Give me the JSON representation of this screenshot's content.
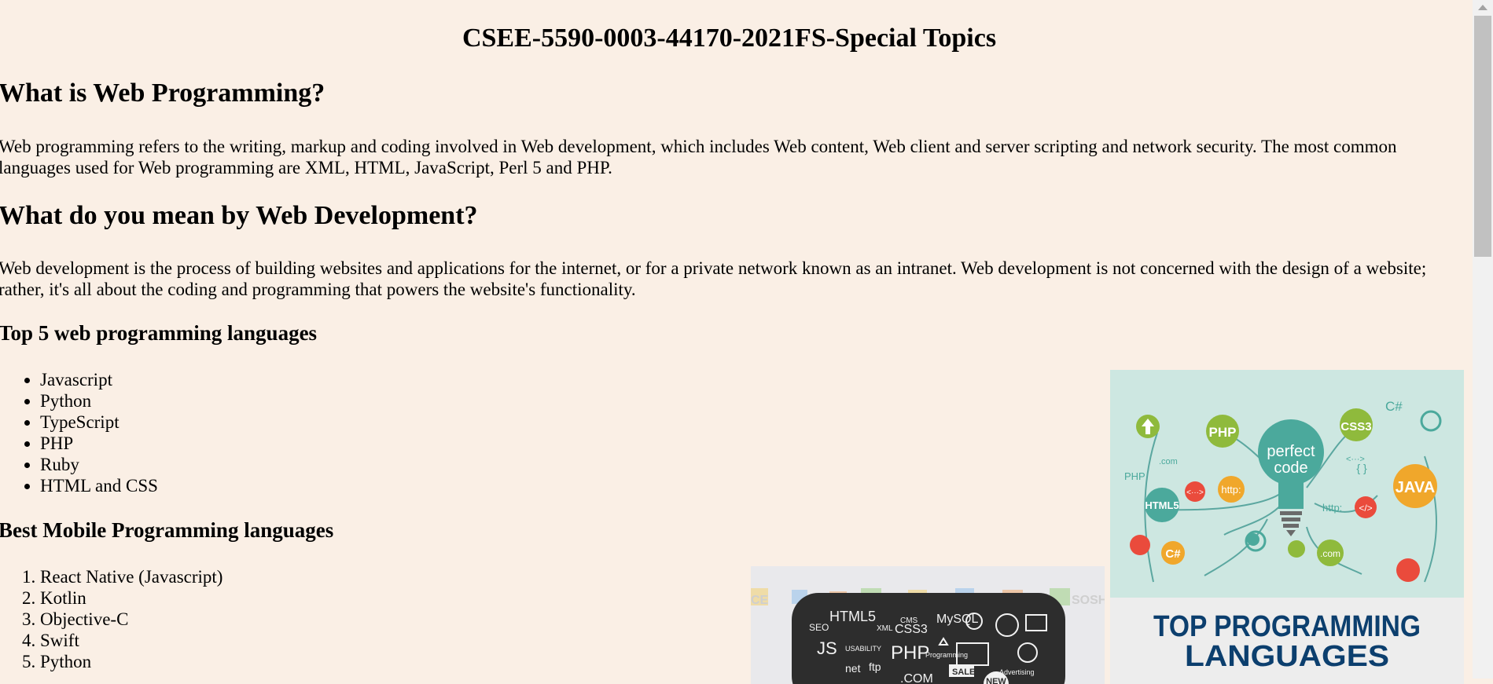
{
  "page": {
    "title": "CSEE-5590-0003-44170-2021FS-Special Topics"
  },
  "sections": {
    "web_programming": {
      "heading": "What is Web Programming?",
      "text": "Web programming refers to the writing, markup and coding involved in Web development, which includes Web content, Web client and server scripting and network security. The most common languages used for Web programming are XML, HTML, JavaScript, Perl 5 and PHP."
    },
    "web_development": {
      "heading": "What do you mean by Web Development?",
      "text": "Web development is the process of building websites and applications for the internet, or for a private network known as an intranet. Web development is not concerned with the design of a website; rather, it's all about the coding and programming that powers the website's functionality."
    },
    "top_web_languages": {
      "heading": "Top 5 web programming languages",
      "items": [
        "Javascript",
        "Python",
        "TypeScript",
        "PHP",
        "Ruby",
        "HTML and CSS"
      ]
    },
    "mobile_languages": {
      "heading": "Best Mobile Programming languages",
      "items": [
        "React Native (Javascript)",
        "Kotlin",
        "Objective-C",
        "Swift",
        "Python"
      ]
    }
  },
  "images": {
    "languages_diagram": {
      "center_text": [
        "perfect",
        "code"
      ],
      "labels": [
        "PHP",
        "CSS3",
        "HTML5",
        "http:",
        "C#",
        "JAVA",
        "</>",
        ".com",
        "{ }",
        "<···>"
      ]
    },
    "top_programming_banner": {
      "text": [
        "TOP PROGRAMMING",
        "LANGUAGES"
      ]
    },
    "chalkboard": {
      "labels": [
        "HTML5",
        "CSS3",
        "MySQL",
        "PHP",
        "JS",
        "XML",
        "CMS",
        "SALE",
        "NEW",
        ".COM",
        "net",
        "ftp",
        "SEO",
        "USABILITY",
        "Programming",
        "Advertising",
        "SOSH"
      ]
    }
  },
  "colors": {
    "background": "#faefe5",
    "teal": "#4ba99c",
    "green": "#8fba3c",
    "orange": "#f0a72b",
    "red": "#ea4b3c",
    "navy": "#0c3f6e"
  }
}
